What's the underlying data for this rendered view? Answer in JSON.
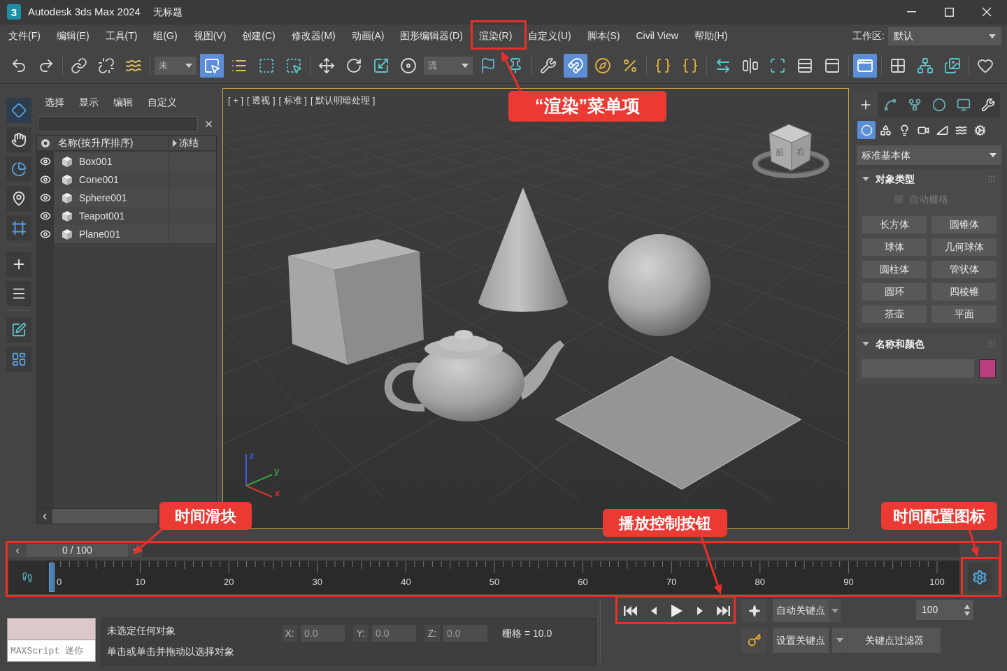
{
  "window": {
    "app_icon": "3",
    "title": "Autodesk 3ds Max 2024",
    "document": "无标题"
  },
  "menu": [
    "文件(F)",
    "编辑(E)",
    "工具(T)",
    "组(G)",
    "视图(V)",
    "创建(C)",
    "修改器(M)",
    "动画(A)",
    "图形编辑器(D)",
    "渲染(R)",
    "自定义(U)",
    "脚本(S)",
    "Civil View",
    "帮助(H)"
  ],
  "workspace": {
    "label": "工作区:",
    "value": "默认"
  },
  "toolbar": [
    {
      "kind": "button",
      "active": false
    },
    {
      "kind": "button",
      "active": false
    },
    {
      "kind": "separator"
    },
    {
      "kind": "button",
      "active": false
    },
    {
      "kind": "button",
      "active": false
    },
    {
      "kind": "button",
      "active": false
    },
    {
      "kind": "separator"
    },
    {
      "kind": "dropdown",
      "value": "未"
    },
    {
      "kind": "button",
      "active": true
    },
    {
      "kind": "button",
      "active": false
    },
    {
      "kind": "button",
      "active": false
    },
    {
      "kind": "button",
      "active": false
    },
    {
      "kind": "separator"
    },
    {
      "kind": "button",
      "active": false
    },
    {
      "kind": "button",
      "active": false
    },
    {
      "kind": "button",
      "active": false
    },
    {
      "kind": "button",
      "active": false
    },
    {
      "kind": "dropdown",
      "value": "流"
    },
    {
      "kind": "button",
      "active": false
    },
    {
      "kind": "button",
      "active": false
    },
    {
      "kind": "separator"
    },
    {
      "kind": "button",
      "active": false
    },
    {
      "kind": "button",
      "active": true
    },
    {
      "kind": "button",
      "active": false
    },
    {
      "kind": "button",
      "active": false
    },
    {
      "kind": "separator"
    },
    {
      "kind": "button",
      "active": false
    },
    {
      "kind": "button",
      "active": false
    },
    {
      "kind": "separator"
    },
    {
      "kind": "button",
      "active": false
    },
    {
      "kind": "button",
      "active": false
    },
    {
      "kind": "button",
      "active": false
    },
    {
      "kind": "button",
      "active": false
    },
    {
      "kind": "button",
      "active": false
    },
    {
      "kind": "separator"
    },
    {
      "kind": "button",
      "active": true
    },
    {
      "kind": "separator"
    },
    {
      "kind": "button",
      "active": false
    },
    {
      "kind": "button",
      "active": false
    },
    {
      "kind": "button",
      "active": false
    },
    {
      "kind": "separator"
    },
    {
      "kind": "button",
      "active": false
    }
  ],
  "left_toolbar": [
    {
      "kind": "button",
      "active": true
    },
    {
      "kind": "button",
      "active": false
    },
    {
      "kind": "button",
      "active": false
    },
    {
      "kind": "button",
      "active": false
    },
    {
      "kind": "button",
      "active": false
    },
    {
      "kind": "separator"
    },
    {
      "kind": "button",
      "active": false
    },
    {
      "kind": "button",
      "active": false
    },
    {
      "kind": "separator"
    },
    {
      "kind": "button",
      "active": false
    },
    {
      "kind": "button",
      "active": false
    }
  ],
  "scene_explorer": {
    "tabs": [
      "选择",
      "显示",
      "编辑",
      "自定义"
    ],
    "columns": [
      "名称(按升序排序)",
      "冻结"
    ],
    "rows": [
      {
        "name": "Box001",
        "visible": true
      },
      {
        "name": "Cone001",
        "visible": true
      },
      {
        "name": "Sphere001",
        "visible": true
      },
      {
        "name": "Teapot001",
        "visible": true
      },
      {
        "name": "Plane001",
        "visible": true
      }
    ]
  },
  "viewport": {
    "active": true,
    "labels": [
      "[ + ]",
      "[ 透视 ]",
      "[ 标准 ]",
      "[ 默认明暗处理 ]"
    ],
    "viewcube": {
      "front": "前",
      "right": "右"
    },
    "axes": [
      {
        "label": "z",
        "color": "#3f5fd6"
      },
      {
        "label": "y",
        "color": "#3aa045"
      },
      {
        "label": "x",
        "color": "#d83232"
      }
    ]
  },
  "command_panel": {
    "tabs": [
      {
        "selected": true
      },
      {
        "selected": false
      },
      {
        "selected": false
      },
      {
        "selected": false
      },
      {
        "selected": false
      },
      {
        "selected": false
      }
    ],
    "categories": [
      {
        "selected": true
      },
      {
        "selected": false
      },
      {
        "selected": false
      },
      {
        "selected": false
      },
      {
        "selected": false
      },
      {
        "selected": false
      },
      {
        "selected": false
      }
    ],
    "dropdown": "标准基本体",
    "object_type": {
      "title": "对象类型",
      "expanded": true,
      "autogrid": {
        "label": "自动栅格",
        "checked": false,
        "disabled": true
      },
      "buttons": [
        "长方体",
        "圆锥体",
        "球体",
        "几何球体",
        "圆柱体",
        "管状体",
        "圆环",
        "四棱锥",
        "茶壶",
        "平面"
      ]
    },
    "name_and_color": {
      "title": "名称和颜色",
      "expanded": true,
      "color": "#bb3f80"
    }
  },
  "timeline": {
    "time_slider": {
      "label": "0 / 100",
      "level": 0
    },
    "frame_labels": [
      "0",
      "10",
      "20",
      "30",
      "40",
      "50",
      "60",
      "70",
      "80",
      "90",
      "100"
    ]
  },
  "status": {
    "listener_placeholder": "MAXScript 迷你",
    "messages": [
      "未选定任何对象",
      "单击或单击并拖动以选择对象"
    ],
    "coordinates": [
      {
        "axis": "X:",
        "value": "0.0"
      },
      {
        "axis": "Y:",
        "value": "0.0"
      },
      {
        "axis": "Z:",
        "value": "0.0"
      }
    ],
    "grid": "栅格 = 10.0"
  },
  "animation": {
    "auto_key": "自动关键点",
    "set_key": "设置关键点",
    "key_filters": "关键点过滤器",
    "frame": "100"
  },
  "annotations": [
    "“渲染”菜单项",
    "时间滑块",
    "播放控制按钮",
    "时间配置图标"
  ]
}
